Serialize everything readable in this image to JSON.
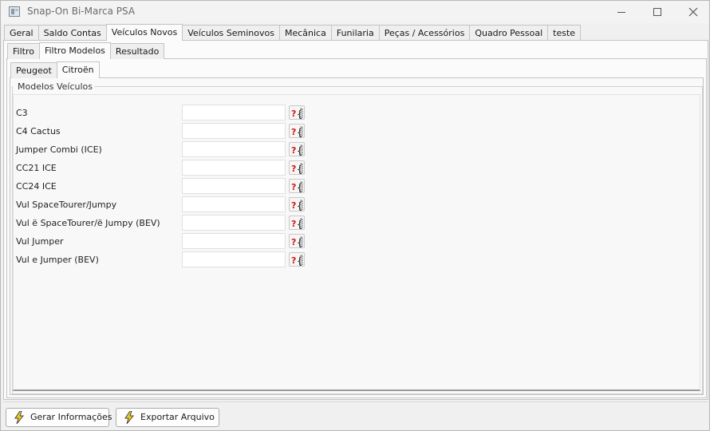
{
  "window": {
    "title": "Snap-On Bi-Marca PSA"
  },
  "main_tabs": [
    {
      "label": "Geral",
      "active": false
    },
    {
      "label": "Saldo Contas",
      "active": false
    },
    {
      "label": "Veículos Novos",
      "active": true
    },
    {
      "label": "Veículos Seminovos",
      "active": false
    },
    {
      "label": "Mecânica",
      "active": false
    },
    {
      "label": "Funilaria",
      "active": false
    },
    {
      "label": "Peças / Acessórios",
      "active": false
    },
    {
      "label": "Quadro Pessoal",
      "active": false
    },
    {
      "label": "teste",
      "active": false
    }
  ],
  "sub_tabs": [
    {
      "label": "Filtro",
      "active": false
    },
    {
      "label": "Filtro Modelos",
      "active": true
    },
    {
      "label": "Resultado",
      "active": false
    }
  ],
  "brand_tabs": [
    {
      "label": "Peugeot",
      "active": false
    },
    {
      "label": "Citroën",
      "active": true
    }
  ],
  "group": {
    "title": "Modelos Veículos"
  },
  "models": [
    {
      "label": "C3",
      "value": ""
    },
    {
      "label": "C4 Cactus",
      "value": ""
    },
    {
      "label": "Jumper Combi (ICE)",
      "value": ""
    },
    {
      "label": "CC21 ICE",
      "value": ""
    },
    {
      "label": "CC24 ICE",
      "value": ""
    },
    {
      "label": "Vul SpaceTourer/Jumpy",
      "value": ""
    },
    {
      "label": "Vul ë SpaceTourer/ë Jumpy (BEV)",
      "value": ""
    },
    {
      "label": "Vul Jumper",
      "value": ""
    },
    {
      "label": "Vul e Jumper (BEV)",
      "value": ""
    }
  ],
  "actions": {
    "gerar_label": "Gerar Informações",
    "exportar_label": "Exportar Arquivo"
  },
  "icons": {
    "help": "help-lookup-icon",
    "action": "lightning-icon"
  },
  "colors": {
    "help_red": "#d01818",
    "bolt_yellow": "#f5d01a"
  }
}
